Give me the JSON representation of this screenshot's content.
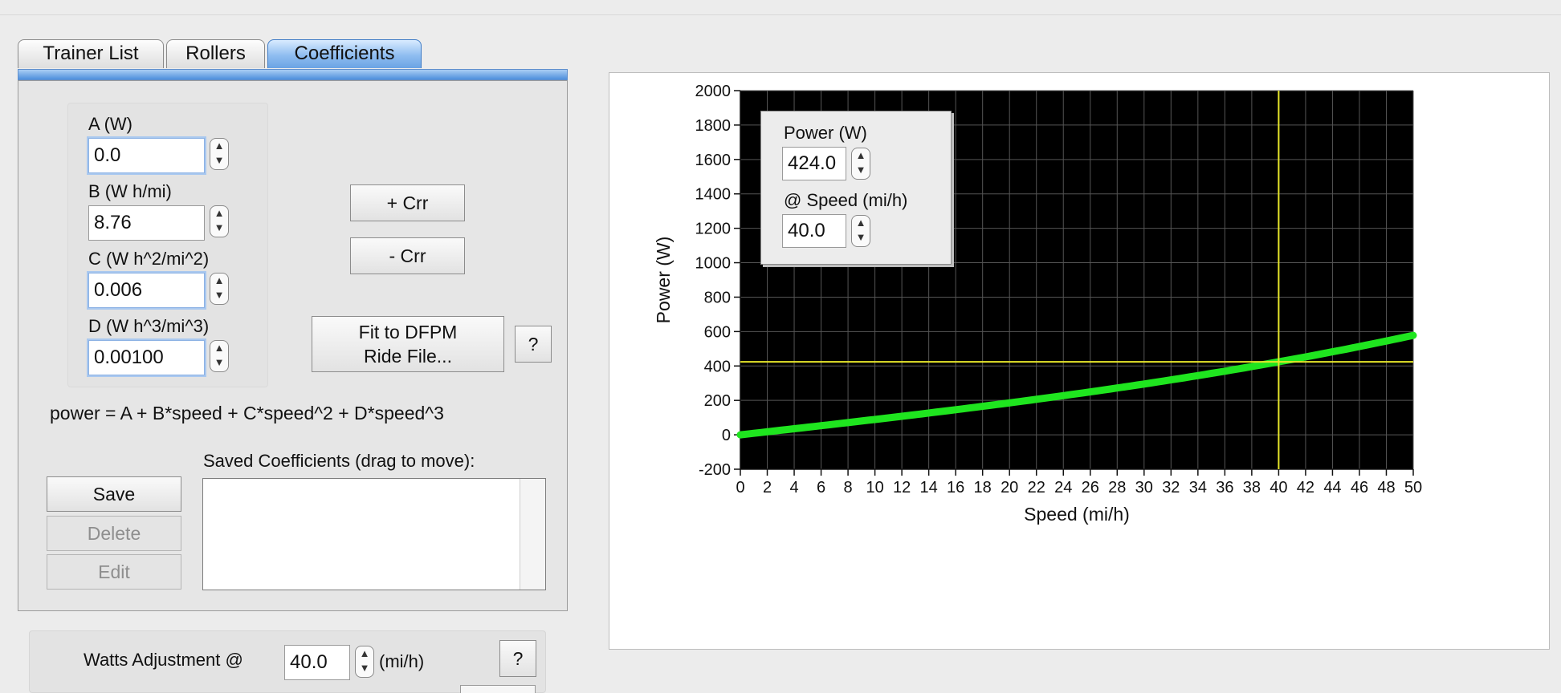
{
  "tabs": [
    {
      "label": "Trainer List"
    },
    {
      "label": "Rollers"
    },
    {
      "label": "Coefficients"
    }
  ],
  "coefficients": {
    "a_label": "A (W)",
    "a_value": "0.0",
    "b_label": "B (W h/mi)",
    "b_value": "8.76",
    "c_label": "C (W h^2/mi^2)",
    "c_value": "0.006",
    "d_label": "D (W h^3/mi^3)",
    "d_value": "0.00100"
  },
  "buttons": {
    "plus_crr": "+ Crr",
    "minus_crr": "- Crr",
    "fit_line1": "Fit to DFPM",
    "fit_line2": "Ride File...",
    "help": "?",
    "save": "Save",
    "delete": "Delete",
    "edit": "Edit"
  },
  "formula": "power = A + B*speed + C*speed^2 + D*speed^3",
  "saved_label": "Saved Coefficients (drag to move):",
  "watts": {
    "label": "Watts Adjustment @",
    "value": "40.0",
    "unit": "(mi/h)",
    "help": "?"
  },
  "cursor_box": {
    "power_label": "Power (W)",
    "power_value": "424.0",
    "speed_label": "@ Speed (mi/h)",
    "speed_value": "40.0"
  },
  "colors": {
    "plot_bg": "#000000",
    "grid": "#555555",
    "curve": "#1fe51f",
    "cursor": "#e6e62a",
    "tab_active": "#8fbdf0"
  },
  "chart_data": {
    "type": "line",
    "xlabel": "Speed (mi/h)",
    "ylabel": "Power (W)",
    "xlim": [
      0,
      50
    ],
    "ylim": [
      -200,
      2000
    ],
    "x_ticks": [
      "0",
      "2",
      "4",
      "6",
      "8",
      "10",
      "12",
      "14",
      "16",
      "18",
      "20",
      "22",
      "24",
      "26",
      "28",
      "30",
      "32",
      "34",
      "36",
      "38",
      "40",
      "42",
      "44",
      "46",
      "48",
      "50"
    ],
    "y_ticks": [
      "-200",
      "0",
      "200",
      "400",
      "600",
      "800",
      "1000",
      "1200",
      "1400",
      "1600",
      "1800",
      "2000"
    ],
    "grid": true,
    "series": [
      {
        "x": [
          0,
          2,
          4,
          6,
          8,
          10,
          12,
          14,
          16,
          18,
          20,
          22,
          24,
          26,
          28,
          30,
          32,
          34,
          36,
          38,
          40,
          42,
          44,
          46,
          48,
          50
        ],
        "y": [
          0,
          17.5,
          35.2,
          53.0,
          71.0,
          93.2,
          113.7,
          135.7,
          160.2,
          187.4,
          222.4,
          251.4,
          282.7,
          316.8,
          353.0,
          392.8,
          435.1,
          481.0,
          530.5,
          583.5,
          424.0,
          460.0,
          500.0,
          540.0,
          575.0,
          590.0
        ]
      }
    ],
    "cursor": {
      "x": 40,
      "y": 424
    }
  }
}
